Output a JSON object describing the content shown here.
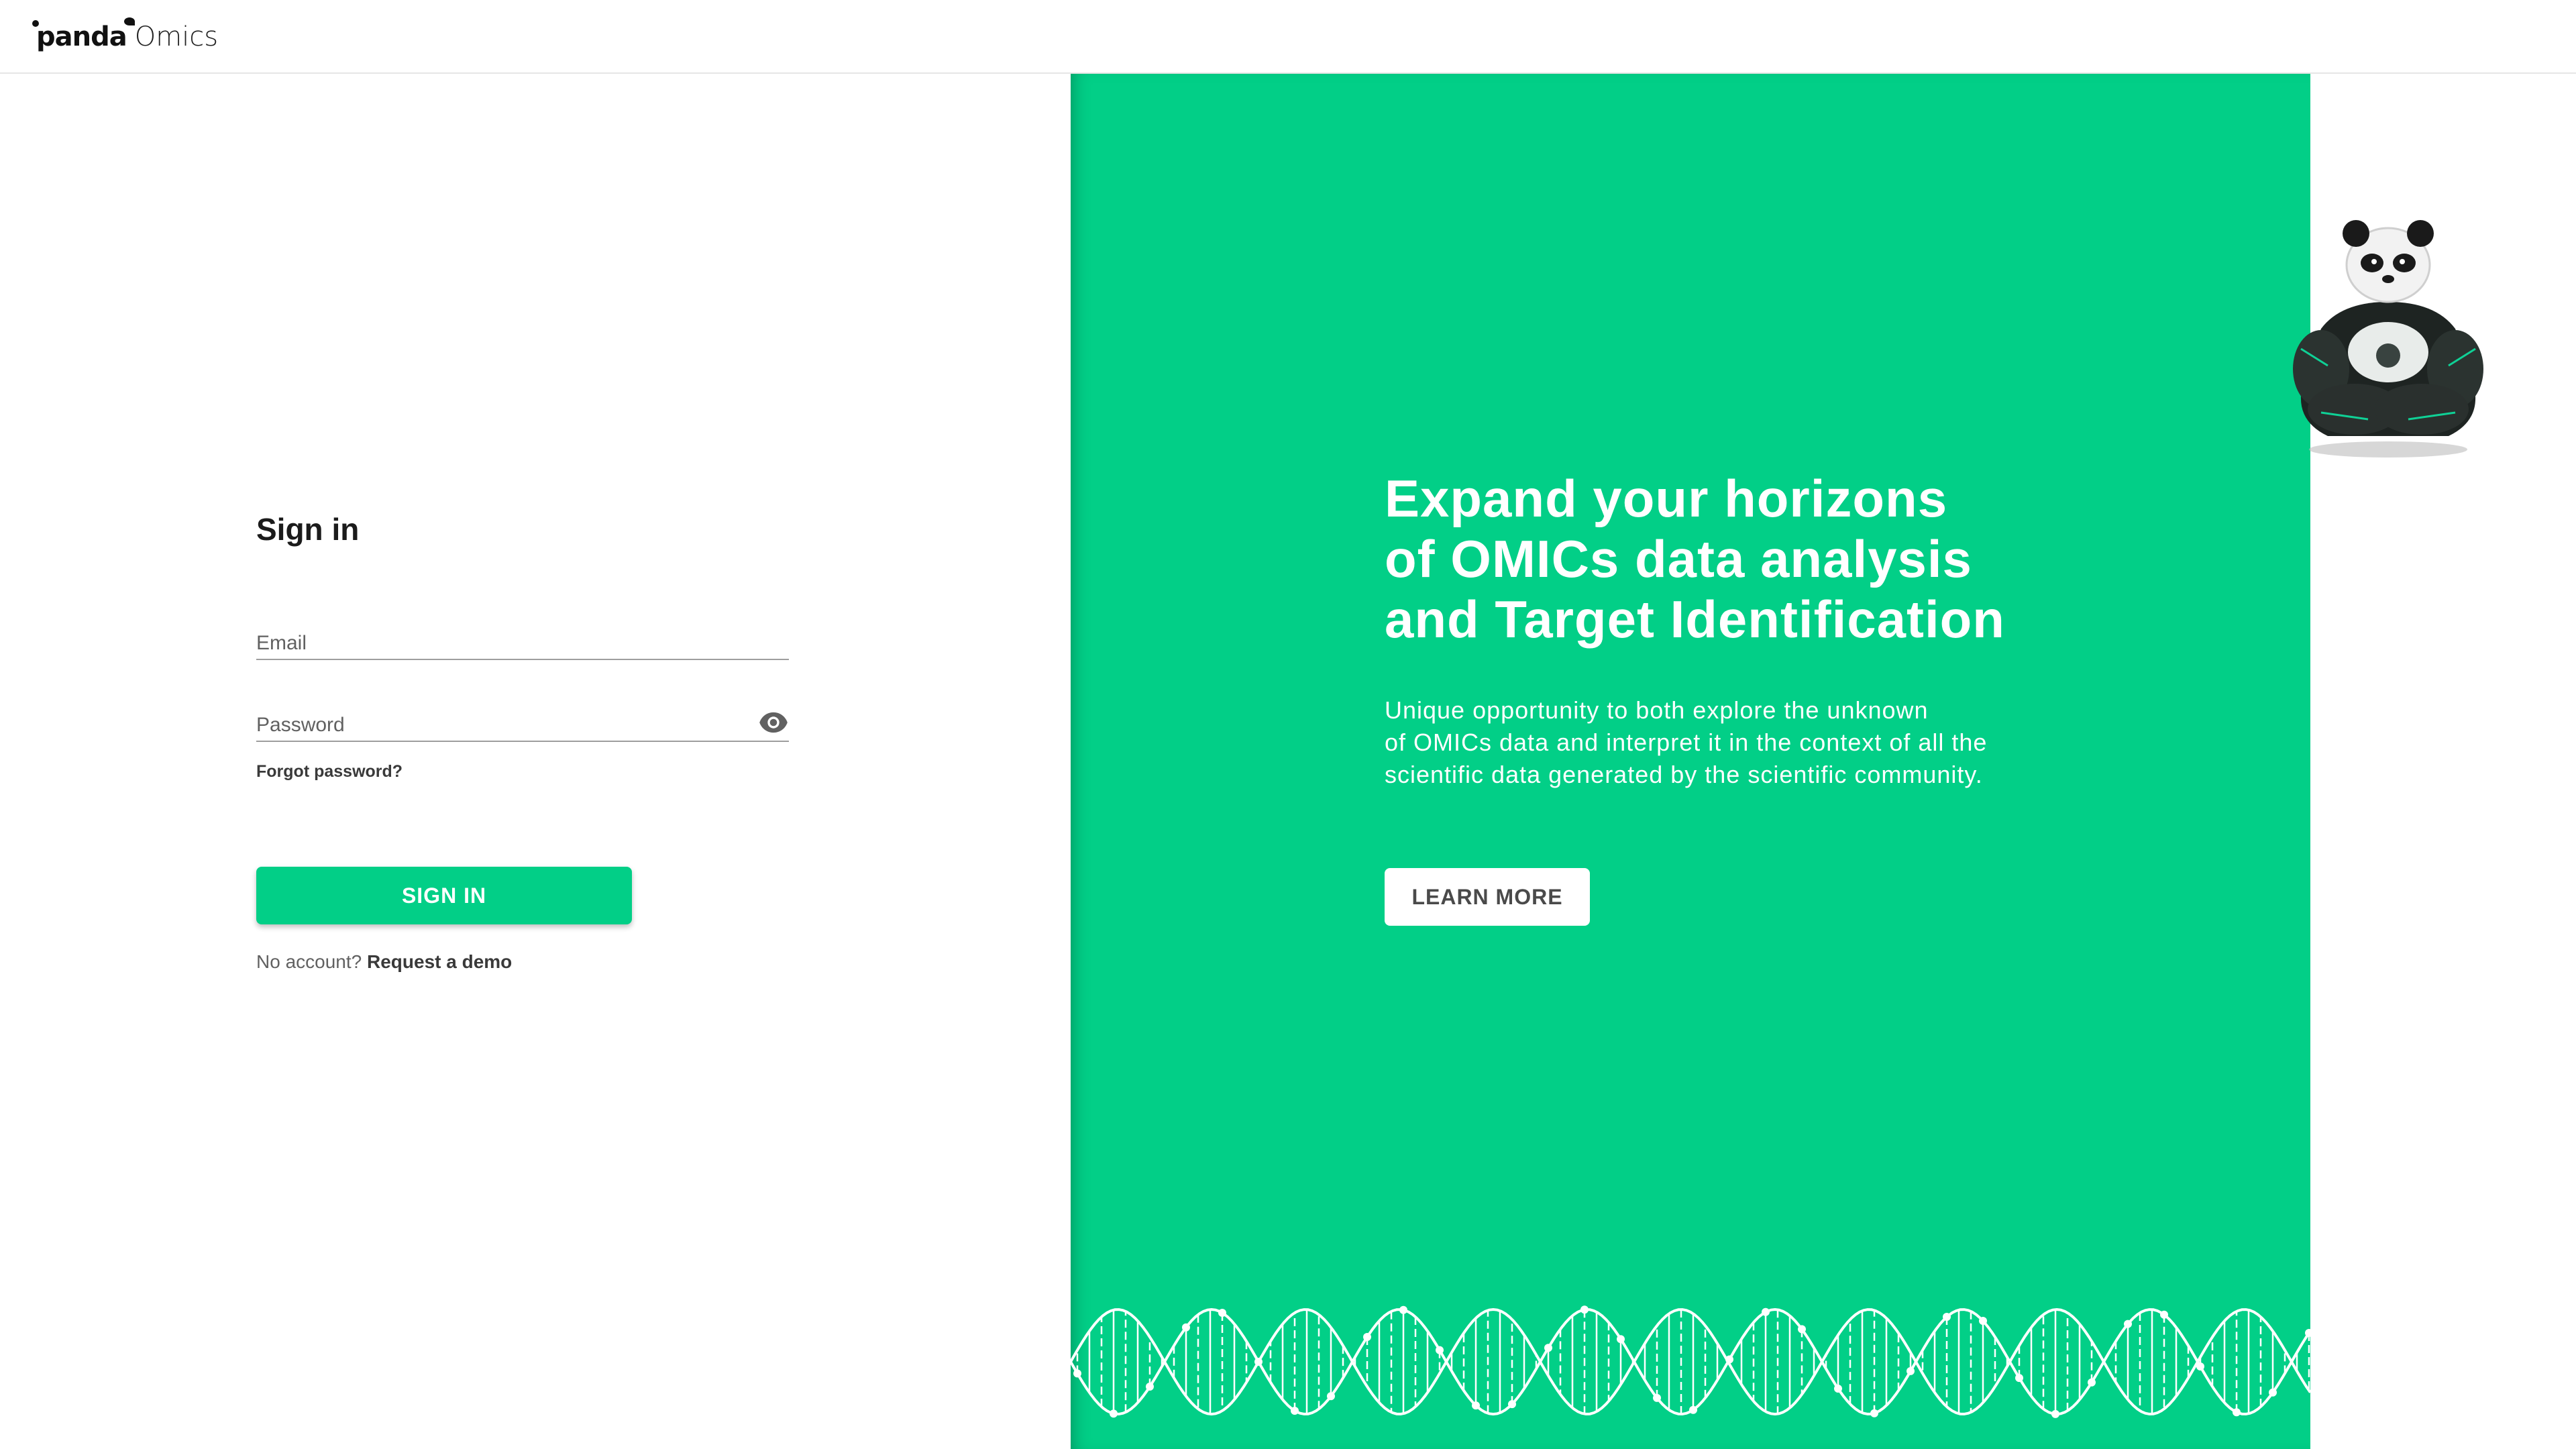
{
  "header": {
    "logo_brand": "panda",
    "logo_product": "Omics"
  },
  "signin": {
    "title": "Sign in",
    "email_label": "Email",
    "password_label": "Password",
    "forgot_label": "Forgot password?",
    "button_label": "SIGN IN",
    "no_account_text": "No account?",
    "request_demo_label": "Request a demo"
  },
  "promo": {
    "headline_lines": [
      "Expand your horizons",
      "of OMICs data analysis",
      "and Target Identification"
    ],
    "description_lines": [
      "Unique opportunity to both explore the unknown",
      "of OMICs data and interpret it in the context of all the",
      "scientific data generated by the scientific community."
    ],
    "button_label": "LEARN MORE"
  },
  "colors": {
    "accent": "#02cf87",
    "text_dark": "#212121",
    "text_muted": "#616161",
    "divider": "#e6e6e6"
  },
  "icons": {
    "password_toggle": "eye-icon",
    "mascot": "panda-mascot-illustration",
    "decoration": "dna-helix"
  }
}
